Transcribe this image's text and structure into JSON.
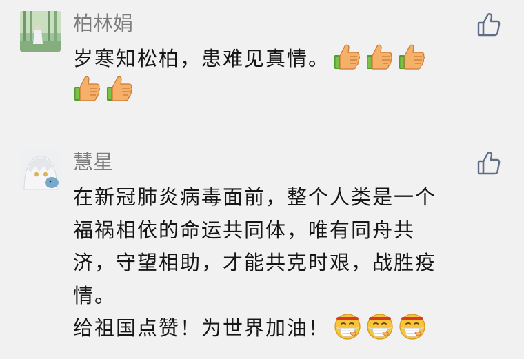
{
  "comments": [
    {
      "author": "柏林娟",
      "lines": [
        "岁寒知松柏，患难见真情。"
      ],
      "emoji_names": [
        "thumbs-up-icon",
        "thumbs-up-icon",
        "thumbs-up-icon",
        "thumbs-up-icon",
        "thumbs-up-icon"
      ]
    },
    {
      "author": "慧星",
      "lines": [
        "在新冠肺炎病毒面前，整个人类是一个",
        "福祸相依的命运共同体，唯有同舟共",
        "济，守望相助，才能共克时艰，战胜疫",
        "情。",
        "给祖国点赞！为世界加油！"
      ],
      "emoji_names": [
        "mask-face-icon",
        "mask-face-icon",
        "mask-face-icon"
      ]
    }
  ],
  "colors": {
    "background": "#f1f1f1",
    "author": "#7d7d7d",
    "text": "#161616",
    "like_icon": "#5f6d86"
  }
}
